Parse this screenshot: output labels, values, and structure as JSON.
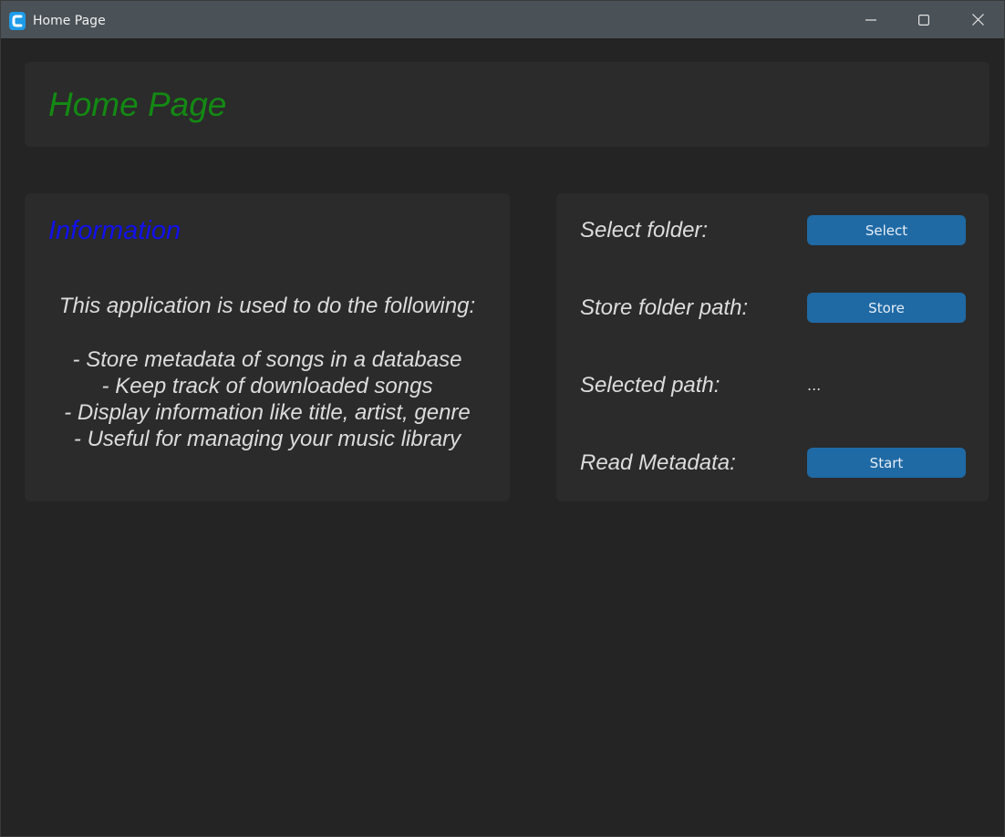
{
  "window": {
    "title": "Home Page",
    "icon": "customtkinter-app-icon",
    "controls": [
      "minimize-icon",
      "maximize-icon",
      "close-icon"
    ]
  },
  "header": {
    "title": "Home Page"
  },
  "info": {
    "heading": "Information",
    "intro": "This application is used to do the following:",
    "items": [
      "- Store metadata of songs in a database",
      "- Keep track of downloaded songs",
      "- Display information like title, artist, genre",
      "- Useful for managing your music library"
    ]
  },
  "actions": {
    "select_folder_label": "Select folder:",
    "select_button": "Select",
    "store_path_label": "Store folder path:",
    "store_button": "Store",
    "selected_path_label": "Selected path:",
    "selected_path_value": "...",
    "read_metadata_label": "Read Metadata:",
    "start_button": "Start"
  },
  "colors": {
    "heading_green": "#138a13",
    "heading_blue": "#1010ee",
    "button_blue": "#1f6aa5",
    "card_bg": "#2b2b2b",
    "window_bg": "#242424",
    "titlebar_bg": "#4a5157"
  }
}
